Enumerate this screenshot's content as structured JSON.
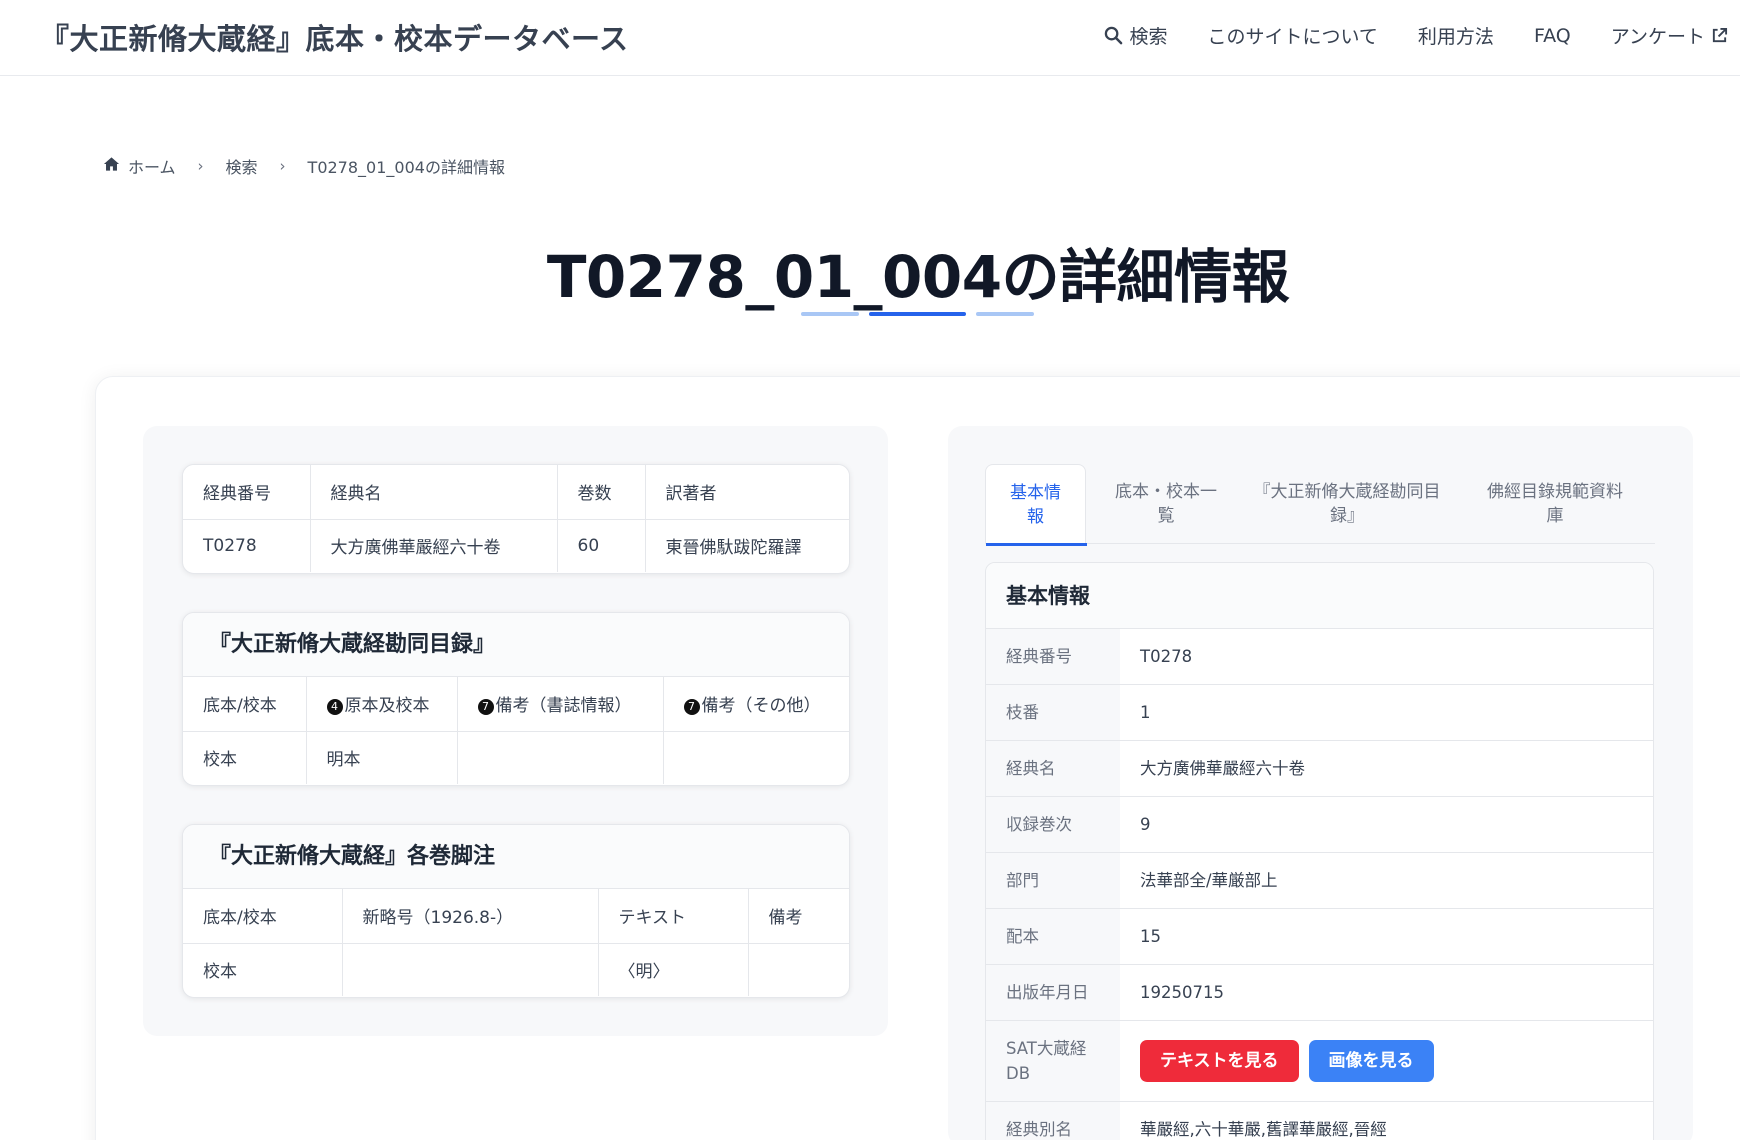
{
  "header": {
    "site_title": "『大正新脩大蔵経』底本・校本データベース",
    "nav": [
      {
        "label": "検索",
        "icon": "search-icon"
      },
      {
        "label": "このサイトについて"
      },
      {
        "label": "利用方法"
      },
      {
        "label": "FAQ"
      },
      {
        "label": "アンケート",
        "icon": "external-link-icon"
      }
    ]
  },
  "breadcrumb": {
    "home": "ホーム",
    "search": "検索",
    "current": "T0278_01_004の詳細情報"
  },
  "page_title": "T0278_01_004の詳細情報",
  "colors": {
    "accent": "#2563eb",
    "accent_light": "#a9c7f5",
    "btn_text": "#ef2b3a",
    "btn_image": "#3b82f6"
  },
  "sutra_table": {
    "headers": [
      "経典番号",
      "経典名",
      "巻数",
      "訳著者"
    ],
    "row": [
      "T0278",
      "大方廣佛華嚴經六十卷",
      "60",
      "東晉佛馱跋陀羅譯"
    ]
  },
  "kando_table": {
    "title": "『大正新脩大蔵経勘同目録』",
    "headers": [
      "底本/校本",
      "原本及校本",
      "備考（書誌情報）",
      "備考（その他）"
    ],
    "header_marks": [
      "",
      "4",
      "7",
      "7"
    ],
    "row": [
      "校本",
      "明本",
      "",
      ""
    ]
  },
  "footnote_table": {
    "title": "『大正新脩大蔵経』各巻脚注",
    "headers": [
      "底本/校本",
      "新略号（1926.8-）",
      "テキスト",
      "備考"
    ],
    "row": [
      "校本",
      "",
      "〈明〉",
      ""
    ]
  },
  "tabs": [
    {
      "label": "基本情\n報",
      "active": true
    },
    {
      "label": "底本・校本一\n覧",
      "active": false
    },
    {
      "label": "『大正新脩大蔵経勘同目\n録』",
      "active": false
    },
    {
      "label": "佛經目錄規範資料\n庫",
      "active": false
    }
  ],
  "basic_info": {
    "title": "基本情報",
    "rows": [
      {
        "label": "経典番号",
        "value": "T0278"
      },
      {
        "label": "枝番",
        "value": "1"
      },
      {
        "label": "経典名",
        "value": "大方廣佛華嚴經六十卷"
      },
      {
        "label": "収録巻次",
        "value": "9"
      },
      {
        "label": "部門",
        "value": "法華部全/華厳部上"
      },
      {
        "label": "配本",
        "value": "15"
      },
      {
        "label": "出版年月日",
        "value": "19250715"
      }
    ],
    "sat_label": "SAT大蔵経DB",
    "btn_text": "テキストを見る",
    "btn_image": "画像を見る",
    "alias_label": "経典別名",
    "alias_value": "華嚴經,六十華嚴,舊譯華嚴經,晉經"
  }
}
